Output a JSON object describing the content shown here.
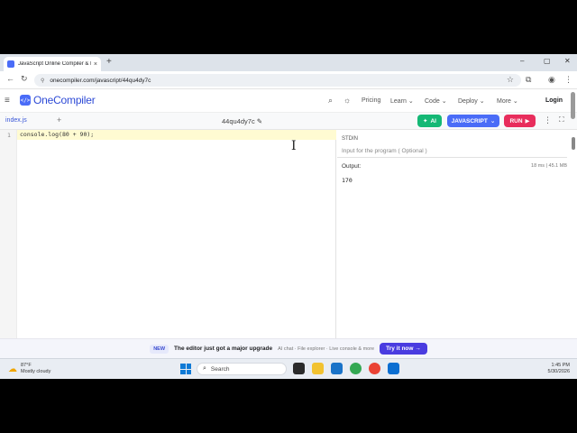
{
  "browser": {
    "tab_title": "JavaScript Online Compiler & I",
    "tab_close": "×",
    "new_tab": "+",
    "url": "onecompiler.com/javascript/44qu4dy7c",
    "window_controls": [
      "–",
      "▢",
      "✕"
    ]
  },
  "site": {
    "logo_text": "OneCompiler",
    "nav": [
      "Pricing",
      "Learn",
      "Code",
      "Deploy",
      "More"
    ],
    "login": "Login"
  },
  "editor": {
    "file_tab": "index.js",
    "add_file": "+",
    "project_name": "44qu4dy7c",
    "ai_label": "AI",
    "language_label": "JAVASCRIPT",
    "run_label": "RUN",
    "line_numbers": [
      "1"
    ],
    "code_lines": [
      "console.log(80 + 90);"
    ]
  },
  "io": {
    "stdin_label": "STDIN",
    "stdin_placeholder": "Input for the program ( Optional )",
    "output_label": "Output:",
    "output_meta": "18 ms | 45.1 MB",
    "output_value": "170"
  },
  "announcement": {
    "badge": "NEW",
    "headline": "The editor just got a major upgrade",
    "details": "AI chat · File explorer · Live console & more",
    "cta": "Try it now →"
  },
  "taskbar": {
    "temperature": "87°F",
    "condition": "Mostly cloudy",
    "search_label": "Search",
    "time": "1:45 PM",
    "date": "5/30/2026"
  }
}
